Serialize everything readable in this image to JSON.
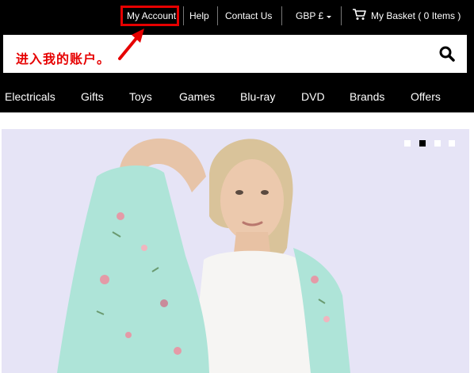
{
  "topbar": {
    "my_account": "My Account",
    "help": "Help",
    "contact_us": "Contact Us",
    "currency": "GBP £",
    "basket": "My Basket ( 0 Items )"
  },
  "annotation": {
    "text": "进入我的账户。"
  },
  "nav": {
    "items": [
      "Electricals",
      "Gifts",
      "Toys",
      "Games",
      "Blu-ray",
      "DVD",
      "Brands",
      "Offers"
    ]
  },
  "carousel": {
    "slide_count": 4,
    "active_slide": 2
  },
  "colors": {
    "annotation": "#e60000",
    "bar": "#000000",
    "hero_bg": "#e6e4f6"
  },
  "icons": {
    "search": "search-icon",
    "basket": "cart-icon",
    "dropdown": "chevron-down-icon",
    "pointer": "arrow-annotation-icon"
  }
}
